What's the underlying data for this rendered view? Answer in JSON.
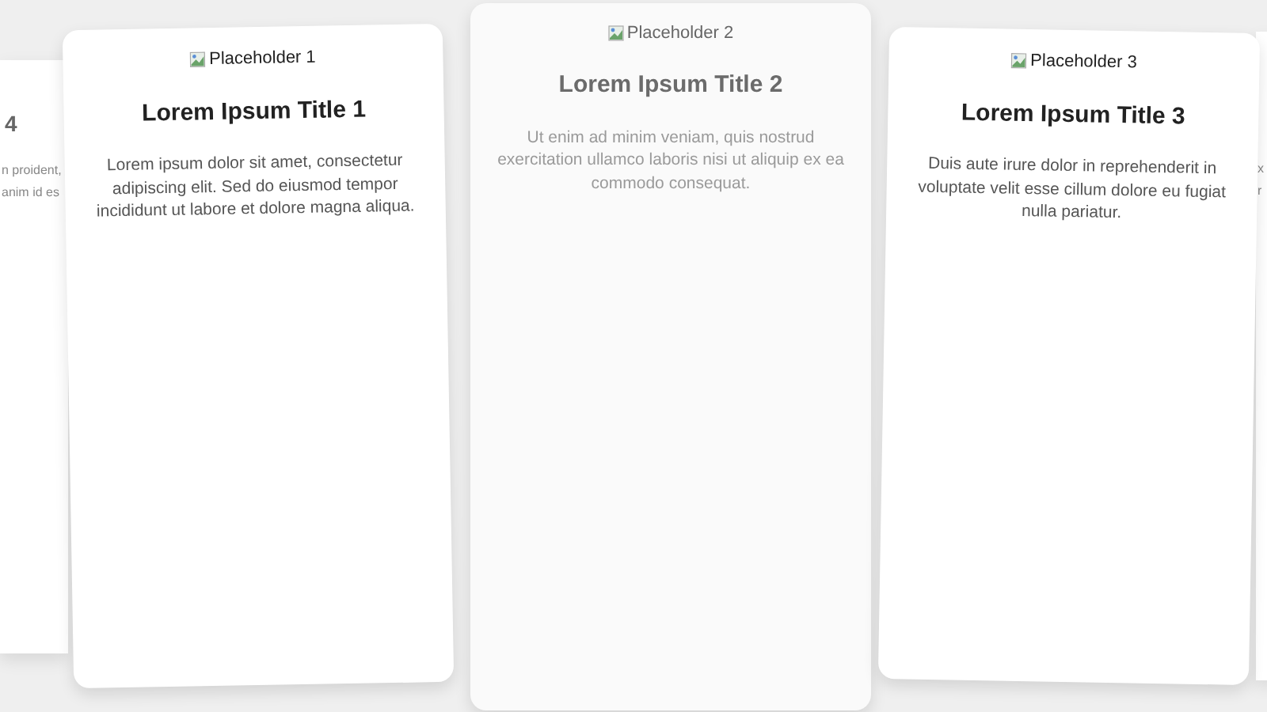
{
  "cards": [
    {
      "kind": "partial_left",
      "title": "4",
      "lines": [
        "n proident,",
        "anim id es"
      ]
    },
    {
      "kind": "full",
      "faded": false,
      "image_alt": "Placeholder 1",
      "title": "Lorem Ipsum Title 1",
      "body": "Lorem ipsum dolor sit amet, consectetur adipiscing elit. Sed do eiusmod tempor incididunt ut labore et dolore magna aliqua."
    },
    {
      "kind": "full",
      "faded": true,
      "image_alt": "Placeholder 2",
      "title": "Lorem Ipsum Title 2",
      "body": "Ut enim ad minim veniam, quis nostrud exercitation ullamco laboris nisi ut aliquip ex ea commodo consequat."
    },
    {
      "kind": "full",
      "faded": false,
      "image_alt": "Placeholder 3",
      "title": "Lorem Ipsum Title 3",
      "body": "Duis aute irure dolor in reprehenderit in voluptate velit esse cillum dolore eu fugiat nulla pariatur."
    },
    {
      "kind": "partial_right",
      "lines": [
        "x",
        "r"
      ]
    }
  ]
}
